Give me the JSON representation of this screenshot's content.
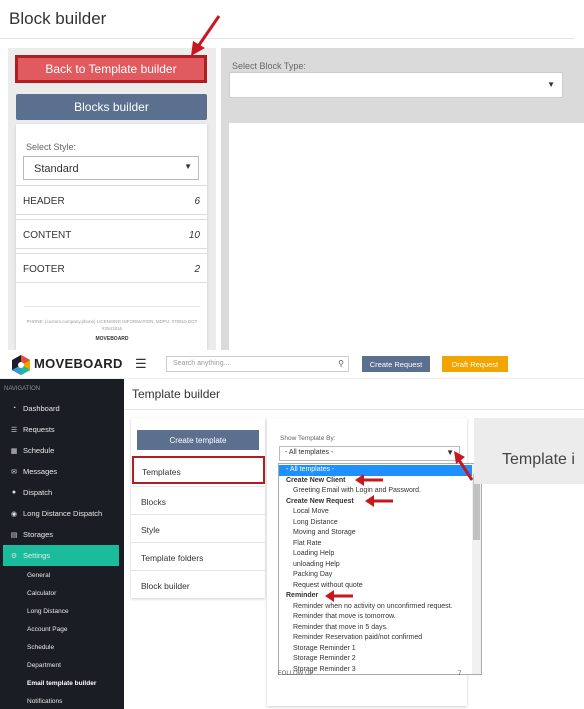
{
  "top": {
    "title": "Block builder",
    "back_button": "Back to Template builder",
    "blocks_button": "Blocks builder",
    "style_label": "Select Style:",
    "style_value": "Standard",
    "sections": [
      {
        "name": "HEADER",
        "count": "6"
      },
      {
        "name": "CONTENT",
        "count": "10"
      },
      {
        "name": "FOOTER",
        "count": "2"
      }
    ],
    "footer_text_1": "PHONE: {custom.company.phone} LICENSING INFORMATION: MDPU: #70910 DOT",
    "footer_text_2": "#2541816",
    "footer_logo": "MOVEBOARD",
    "block_type_label": "Select Block Type:"
  },
  "app": {
    "logo": "MOVEBOARD",
    "search_placeholder": "Search anything...",
    "create_request": "Create Request",
    "draft_request": "Draft Request",
    "nav_header": "NAVIGATION",
    "nav": [
      {
        "label": "Dashboard",
        "icon": "dashboard-icon"
      },
      {
        "label": "Requests",
        "icon": "list-icon"
      },
      {
        "label": "Schedule",
        "icon": "calendar-icon"
      },
      {
        "label": "Messages",
        "icon": "envelope-icon"
      },
      {
        "label": "Dispatch",
        "icon": "user-icon"
      },
      {
        "label": "Long Distance Dispatch",
        "icon": "globe-icon"
      },
      {
        "label": "Storages",
        "icon": "storage-icon"
      },
      {
        "label": "Settings",
        "icon": "gear-icon"
      }
    ],
    "subnav": [
      "General",
      "Calculator",
      "Long Distance",
      "Account Page",
      "Schedule",
      "Department",
      "Email template builder",
      "Notifications"
    ],
    "page_title": "Template builder",
    "create_template": "Create template",
    "menu": [
      "Templates",
      "Blocks",
      "Style",
      "Template folders",
      "Block builder"
    ],
    "show_label": "Show Template By:",
    "show_value": "- All templates -",
    "dropdown": [
      {
        "text": "- All templates -",
        "kind": "highlight"
      },
      {
        "text": "Create New Client",
        "kind": "group"
      },
      {
        "text": "Greeting Email with Login and Password.",
        "kind": "item"
      },
      {
        "text": "Create New Request",
        "kind": "group"
      },
      {
        "text": "Local Move",
        "kind": "item"
      },
      {
        "text": "Long Distance",
        "kind": "item"
      },
      {
        "text": "Moving and Storage",
        "kind": "item"
      },
      {
        "text": "Flat Rate",
        "kind": "item"
      },
      {
        "text": "Loading Help",
        "kind": "item"
      },
      {
        "text": "unloading Help",
        "kind": "item"
      },
      {
        "text": "Packing Day",
        "kind": "item"
      },
      {
        "text": "Request without quote",
        "kind": "item"
      },
      {
        "text": "Reminder",
        "kind": "group"
      },
      {
        "text": "Reminder when no activity on unconfirmed request.",
        "kind": "item"
      },
      {
        "text": "Reminder that move is tomorrow.",
        "kind": "item"
      },
      {
        "text": "Reminder that move in 5 days.",
        "kind": "item"
      },
      {
        "text": "Reminder Reservation paid/not confirmed",
        "kind": "item"
      },
      {
        "text": "Storage Reminder 1",
        "kind": "item"
      },
      {
        "text": "Storage Reminder 2",
        "kind": "item"
      },
      {
        "text": "Storage Reminder 3",
        "kind": "item"
      }
    ],
    "footer_row": "FOLLOW UP",
    "footer_row_count": "7",
    "preview_label": "Template i"
  },
  "colors": {
    "arrow": "#c8171e",
    "accent": "#1abc9c",
    "primary_btn": "#5b6f8f",
    "draft_btn": "#f0a500"
  }
}
